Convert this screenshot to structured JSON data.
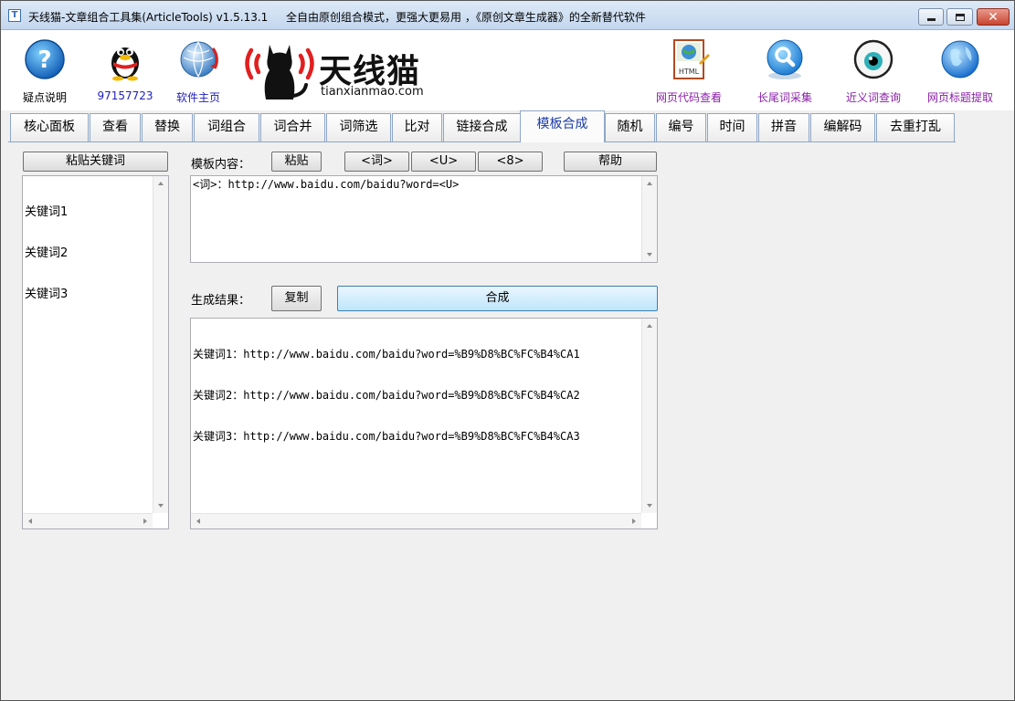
{
  "window": {
    "title": "天线猫-文章组合工具集(ArticleTools) v1.5.13.1",
    "slogan": "全自由原创组合模式，更强大更易用 ，《原创文章生成器》的全新替代软件",
    "icon_name": "app-icon"
  },
  "toolbar": {
    "left": [
      {
        "label": "疑点说明",
        "icon": "help-icon"
      },
      {
        "label": "97157723",
        "icon": "qq-penguin-icon"
      },
      {
        "label": "软件主页",
        "icon": "globe-icon"
      }
    ],
    "logo": {
      "name": "天线猫",
      "url": "tianxianmao.com"
    },
    "right": [
      {
        "label": "网页代码查看",
        "icon": "html-file-icon"
      },
      {
        "label": "长尾词采集",
        "icon": "magnifier-icon"
      },
      {
        "label": "近义词查询",
        "icon": "eye-icon"
      },
      {
        "label": "网页标题提取",
        "icon": "globe-icon"
      }
    ]
  },
  "tabs": [
    "核心面板",
    "查看",
    "替换",
    "词组合",
    "词合并",
    "词筛选",
    "比对",
    "链接合成",
    "模板合成",
    "随机",
    "编号",
    "时间",
    "拼音",
    "编解码",
    "去重打乱"
  ],
  "active_tab": "模板合成",
  "keywords_panel": {
    "paste_button": "粘贴关键词",
    "lines": [
      "关键词1",
      "关键词2",
      "关键词3"
    ]
  },
  "template": {
    "label": "模板内容：",
    "paste_button": "粘贴",
    "tag_buttons": [
      "<词>",
      "<U>",
      "<8>"
    ],
    "help_button": "帮助",
    "content": "<词>：http://www.baidu.com/baidu?word=<U>"
  },
  "result": {
    "label": "生成结果：",
    "copy_button": "复制",
    "compose_button": "合成",
    "lines": [
      "关键词1：http://www.baidu.com/baidu?word=%B9%D8%BC%FC%B4%CA1",
      "关键词2：http://www.baidu.com/baidu?word=%B9%D8%BC%FC%B4%CA2",
      "关键词3：http://www.baidu.com/baidu?word=%B9%D8%BC%FC%B4%CA3"
    ]
  },
  "colors": {
    "accent": "#1b3ba8",
    "link_blue": "#2020c0",
    "link_purple": "#8a1fa8",
    "logo_red": "#e02020"
  }
}
